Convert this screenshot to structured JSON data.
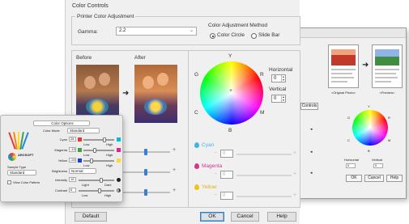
{
  "window": {
    "title": "Color Controls"
  },
  "printer_adjustment": {
    "group_label": "Printer Color Adjustment",
    "gamma_label": "Gamma:",
    "gamma_value": "2.2",
    "method_label": "Color Adjustment Method",
    "method_options": [
      "Color Circle",
      "Slide Bar"
    ],
    "method_selected": "Color Circle"
  },
  "preview": {
    "before_label": "Before",
    "after_label": "After"
  },
  "color_circle": {
    "markers": {
      "top": "Y",
      "right_top": "R",
      "right_bottom": "M",
      "bottom": "B",
      "left_bottom": "C",
      "left_top": "G"
    },
    "horizontal_label": "Horizontal",
    "horizontal_value": "0",
    "vertical_label": "Vertical",
    "vertical_value": "0"
  },
  "ink_sliders": [
    {
      "name": "Cyan",
      "value": "0",
      "color": "#3fb4e6"
    },
    {
      "name": "Magenta",
      "value": "0",
      "color": "#d6338a"
    },
    {
      "name": "Yellow",
      "value": "0",
      "color": "#f2c21b"
    }
  ],
  "buttons": {
    "default": "Default",
    "ok": "OK",
    "cancel": "Cancel",
    "help": "Help"
  },
  "right_window": {
    "thumb_labels": [
      "<Original Photo>",
      "<Preview>"
    ],
    "button_controls": "Controls",
    "horizontal_label": "Horizontal",
    "vertical_label": "Vertical",
    "h_value": "0",
    "v_value": "0",
    "buttons": {
      "ok": "OK",
      "cancel": "Cancel",
      "help": "Help"
    },
    "markers": {
      "top": "Y",
      "right_top": "R",
      "right_bottom": "M",
      "bottom": "B",
      "left_bottom": "C",
      "left_top": "G"
    }
  },
  "mac_dialog": {
    "popup_label": "Color Options",
    "mode_label": "Color Mode",
    "mode_value": "Standard",
    "rows": [
      {
        "label": "Cyan",
        "value": "28",
        "low": "Low",
        "high": "High"
      },
      {
        "label": "Magenta",
        "value": "-13",
        "low": "Low",
        "high": "High"
      },
      {
        "label": "Yellow",
        "value": "-24",
        "low": "Low",
        "high": "High"
      },
      {
        "label": "Brightness",
        "value": "Normal"
      },
      {
        "label": "Intensity",
        "value": "19",
        "low": "Light",
        "high": "Dark"
      },
      {
        "label": "Contrast",
        "value": "6",
        "low": "Low",
        "high": "High"
      }
    ],
    "brand": "ARCSOFT",
    "sample_label": "Sample Type",
    "sample_value": "Standard",
    "view_pattern": "View Color Pattern"
  }
}
